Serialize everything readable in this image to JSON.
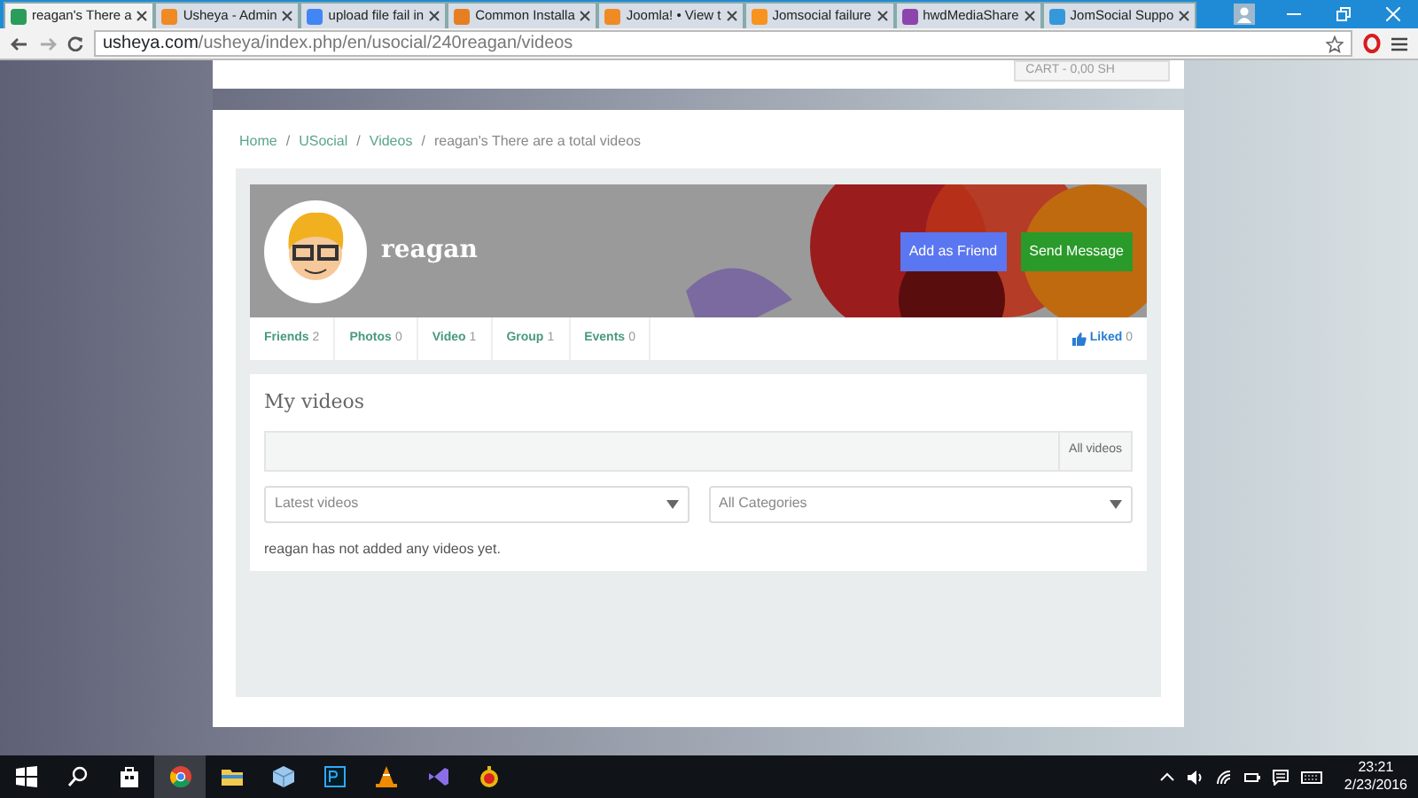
{
  "browser": {
    "tabs": [
      {
        "title": "reagan's There a",
        "selected": true
      },
      {
        "title": "Usheya - Admin",
        "selected": false
      },
      {
        "title": "upload file fail in",
        "selected": false
      },
      {
        "title": "Common Installa",
        "selected": false
      },
      {
        "title": "Joomla! • View t",
        "selected": false
      },
      {
        "title": "Jomsocial failure",
        "selected": false
      },
      {
        "title": "hwdMediaShare",
        "selected": false
      },
      {
        "title": "JomSocial Suppo",
        "selected": false
      }
    ],
    "url_host": "usheya.com",
    "url_path": "/usheya/index.php/en/usocial/240reagan/videos"
  },
  "page": {
    "cart": "CART - 0,00 SH",
    "breadcrumb": [
      {
        "label": "Home",
        "link": true
      },
      {
        "separator": "/",
        "label": "USocial",
        "link": true
      },
      {
        "separator": "/",
        "label": "Videos",
        "link": true
      },
      {
        "separator": "/",
        "label": "reagan's There are a total videos",
        "link": false
      }
    ],
    "profile": {
      "name": "reagan",
      "buttons": [
        {
          "label": "Add as Friend",
          "kind": "primary"
        },
        {
          "label": "Send Message",
          "kind": "success"
        }
      ],
      "stats": [
        {
          "label": "Friends",
          "count": "2"
        },
        {
          "label": "Photos",
          "count": "0"
        },
        {
          "label": "Video",
          "count": "1"
        },
        {
          "label": "Group",
          "count": "1"
        },
        {
          "label": "Events",
          "count": "0"
        }
      ],
      "liked": {
        "label": "Liked",
        "count": "0"
      }
    },
    "videos": {
      "title": "My videos",
      "filter_tab": "All videos",
      "sort_select": "Latest videos",
      "category_select": "All Categories",
      "empty_message": "reagan has not added any videos yet."
    }
  },
  "taskbar": {
    "time": "23:21",
    "date": "2/23/2016"
  }
}
